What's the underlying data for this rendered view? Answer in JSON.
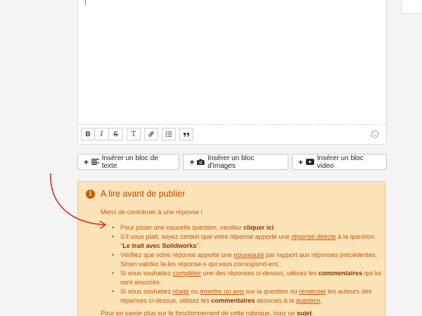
{
  "toolbar": {
    "bold": "B",
    "italic": "I",
    "strike": "S",
    "text": "T"
  },
  "inserts": {
    "text_block": "Insérer un bloc de texte",
    "image_block": "Insérer un bloc d'images",
    "video_block": "Insérer un bloc video"
  },
  "notice": {
    "title": "A lire avant de publier",
    "intro": "Merci de contribuer à une réponse !",
    "b1_pre": "Pour poser une nouvelle question, veuillez ",
    "b1_link": "cliquer ici",
    "b1_post": ".",
    "b2_pre": "S'il vous plait, soyez certain que votre réponse apporte une ",
    "b2_link": "réponse directe",
    "b2_mid": " à la question ",
    "b2_quote_open": "\"",
    "b2_question": "Le trait avec Solidworks",
    "b2_quote_close": "\".",
    "b3_pre": "Vérifiez que votre réponse apporte une ",
    "b3_link": "nouveauté",
    "b3_post": " par rapport aux réponses précédentes. Sinon validez la-les réponse-s qui vous correspond-ent.",
    "b4_pre": "Si vous souhaitez ",
    "b4_link": "compléter",
    "b4_mid": " une des réponses ci-dessus, utilisez les ",
    "b4_bold": "commentaires",
    "b4_post": " qui lui sont associés.",
    "b5_pre": "Si vous souhaitez ",
    "b5_link1": "réagir",
    "b5_or": " ou ",
    "b5_link2": "émettre un avis",
    "b5_mid": " sur la question ou ",
    "b5_link3": "remercier",
    "b5_mid2": " les auteurs des réponses ci-dessus, utilisez les ",
    "b5_bold": "commentaires",
    "b5_mid3": " associés à la ",
    "b5_link4": "question",
    "b5_post": ".",
    "footer_pre": "Pour en savoir plus sur le fonctionnement de cette rubrique, lisez ce ",
    "footer_link": "sujet",
    "footer_post": "."
  },
  "colors": {
    "notice_bg": "#fde3b8",
    "notice_text": "#c4570a",
    "arrow": "#e0301e"
  }
}
